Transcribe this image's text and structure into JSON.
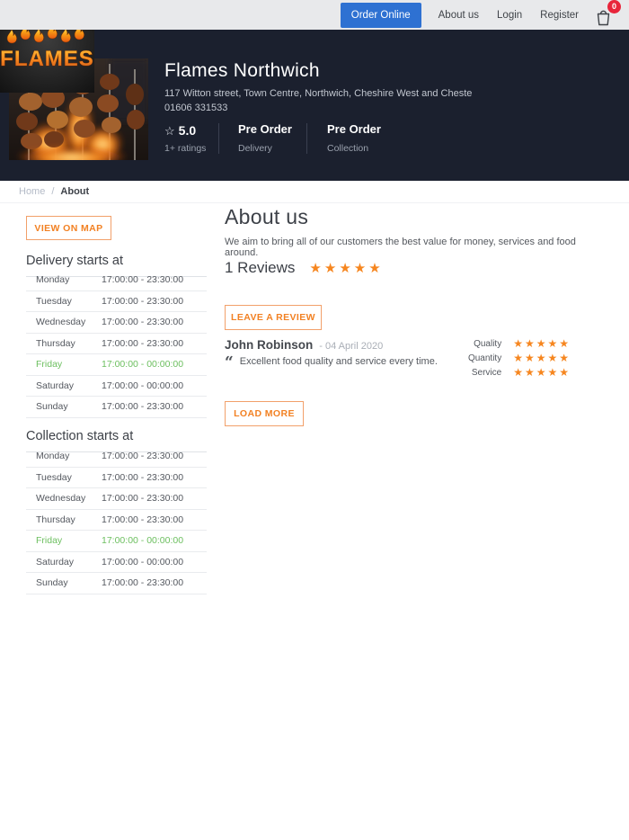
{
  "nav": {
    "order_online": "Order Online",
    "links": [
      "About us",
      "Login",
      "Register"
    ],
    "cart_count": "0"
  },
  "header": {
    "logo_text": "FLAMES",
    "name": "Flames Northwich",
    "address": "117 Witton street, Town Centre, Northwich, Cheshire West and Cheste",
    "phone": "01606 331533",
    "rating": {
      "star": "☆",
      "score": "5.0",
      "count": "1+ ratings"
    },
    "preorder": [
      {
        "title": "Pre Order",
        "subtitle": "Delivery"
      },
      {
        "title": "Pre Order",
        "subtitle": "Collection"
      }
    ]
  },
  "breadcrumb": {
    "home": "Home",
    "separator": "/",
    "current": "About"
  },
  "sidebar": {
    "view_on_map": "VIEW ON MAP",
    "delivery": {
      "title": "Delivery starts at",
      "rows": [
        {
          "day": "Monday",
          "time": "17:00:00 - 23:30:00"
        },
        {
          "day": "Tuesday",
          "time": "17:00:00 - 23:30:00"
        },
        {
          "day": "Wednesday",
          "time": "17:00:00 - 23:30:00"
        },
        {
          "day": "Thursday",
          "time": "17:00:00 - 23:30:00"
        },
        {
          "day": "Friday",
          "time": "17:00:00 - 00:00:00"
        },
        {
          "day": "Saturday",
          "time": "17:00:00 - 00:00:00"
        },
        {
          "day": "Sunday",
          "time": "17:00:00 - 23:30:00"
        }
      ]
    },
    "collection": {
      "title": "Collection starts at",
      "rows": [
        {
          "day": "Monday",
          "time": "17:00:00 - 23:30:00"
        },
        {
          "day": "Tuesday",
          "time": "17:00:00 - 23:30:00"
        },
        {
          "day": "Wednesday",
          "time": "17:00:00 - 23:30:00"
        },
        {
          "day": "Thursday",
          "time": "17:00:00 - 23:30:00"
        },
        {
          "day": "Friday",
          "time": "17:00:00 - 00:00:00"
        },
        {
          "day": "Saturday",
          "time": "17:00:00 - 00:00:00"
        },
        {
          "day": "Sunday",
          "time": "17:00:00 - 23:30:00"
        }
      ]
    }
  },
  "main": {
    "title": "About us",
    "description": "We aim to bring all of our customers the best value for money, services and food around.",
    "reviews": {
      "title": "1 Reviews",
      "stars": "★★★★★",
      "leave_button": "LEAVE A REVIEW",
      "review": {
        "name": "John Robinson",
        "date": "- 04 April 2020",
        "quote_mark": "“",
        "quote": "Excellent food quality and service every time.",
        "ratings": [
          {
            "label": "Quality",
            "stars": "★★★★★"
          },
          {
            "label": "Quantity",
            "stars": "★★★★★"
          },
          {
            "label": "Service",
            "stars": "★★★★★"
          }
        ]
      },
      "load_more": "LOAD MORE"
    }
  },
  "colors": {
    "accent_orange": "#f6861f",
    "button_blue": "#2e71d2",
    "badge_red": "#e8253b",
    "header_navy": "#1b202e",
    "open_green": "#6cbf5f"
  }
}
